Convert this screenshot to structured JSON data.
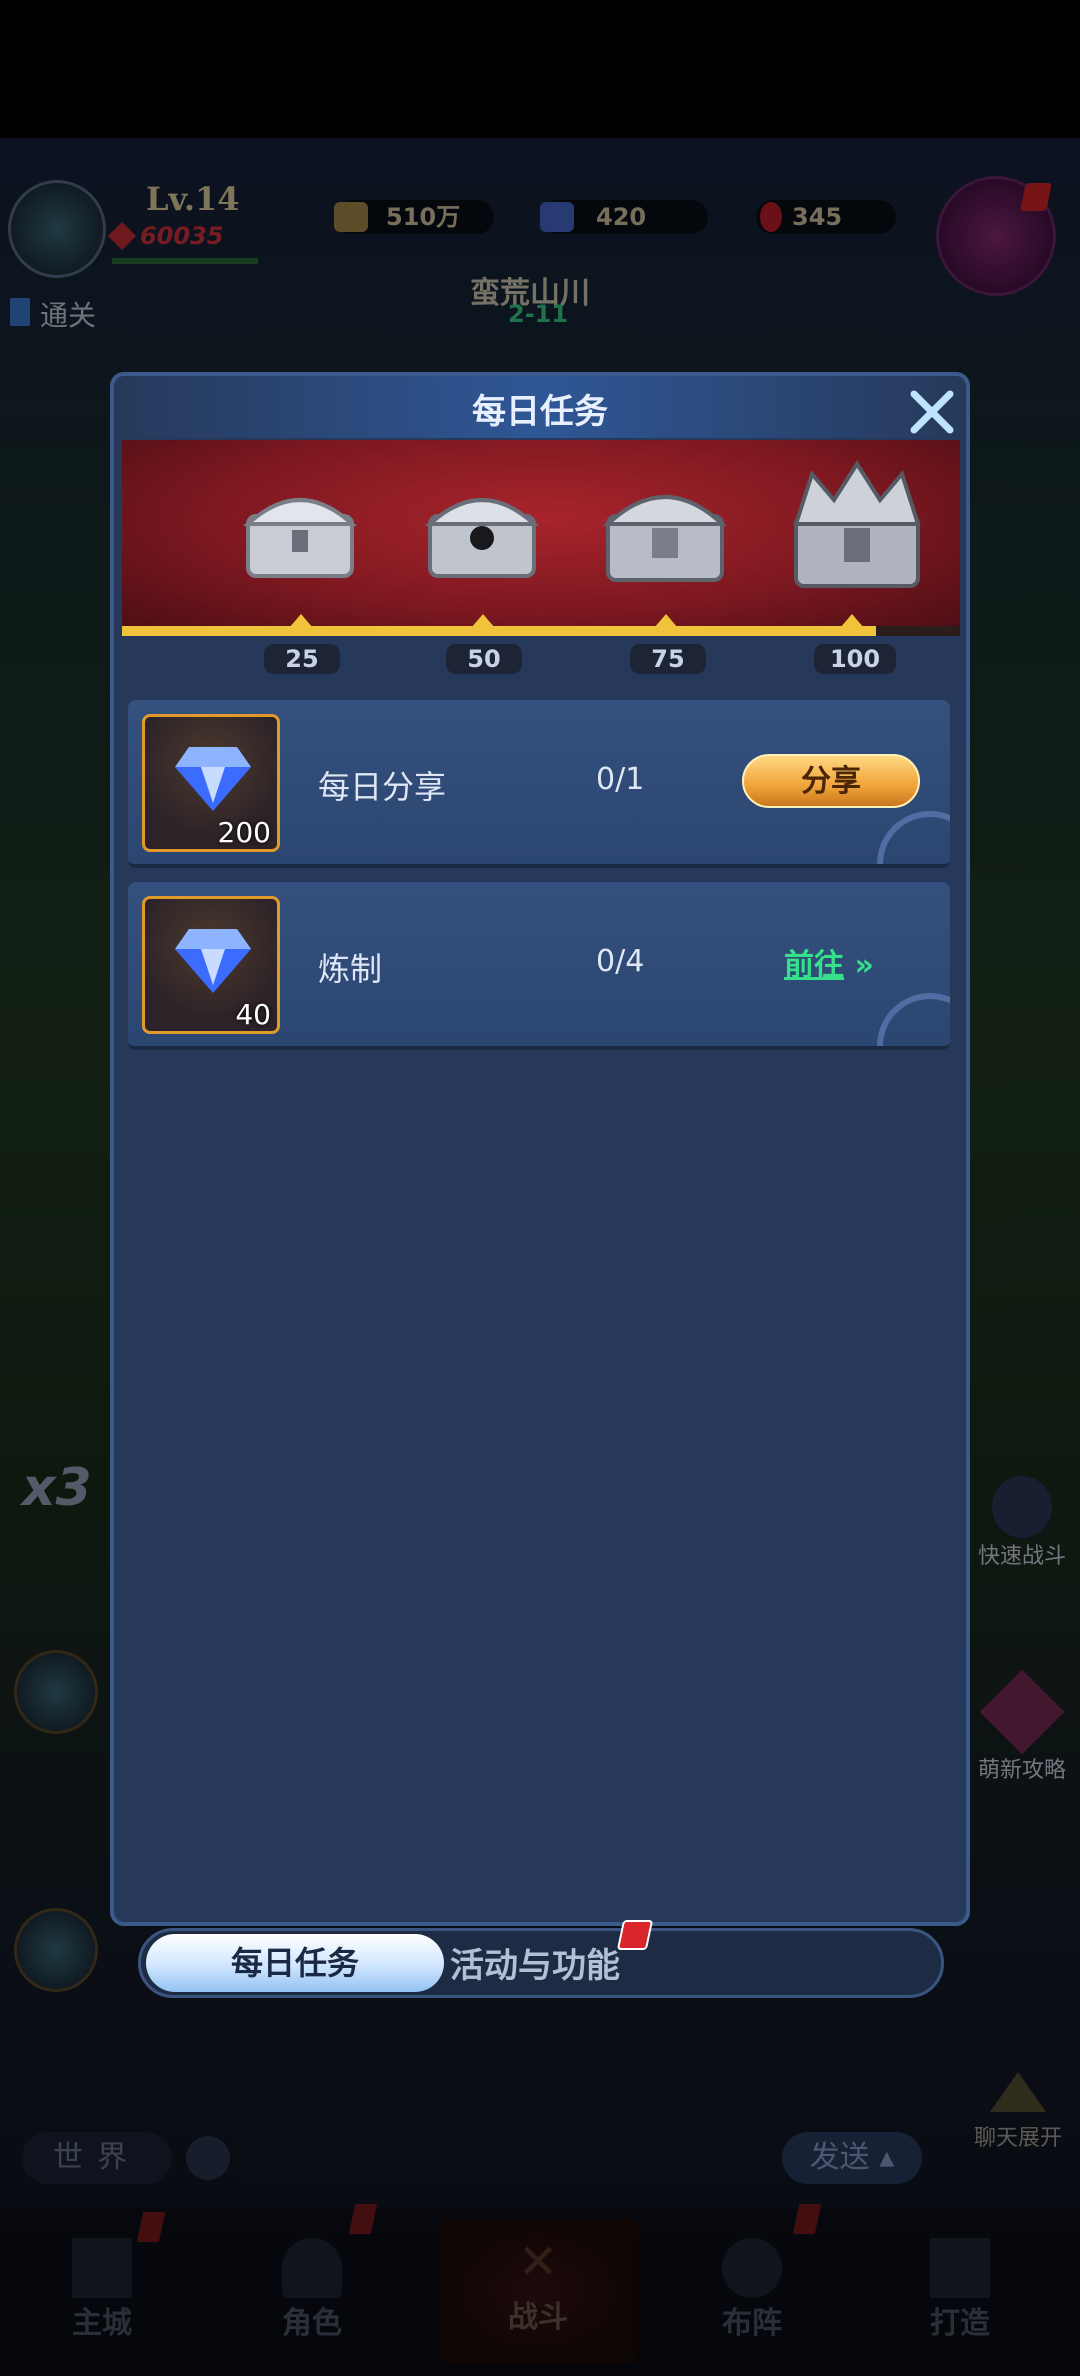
{
  "hud": {
    "level": "Lv.14",
    "power": "60035",
    "gold": "510万",
    "diamonds": "420",
    "gems": "345",
    "stage_name": "蛮荒山川",
    "stage_code": "2-11",
    "left_hint": "通关"
  },
  "side": {
    "speed": "x3",
    "quick_battle": "快速战斗",
    "guide": "萌新攻略",
    "chat_expand": "聊天展开"
  },
  "modal": {
    "title": "每日任务",
    "milestones": [
      "25",
      "50",
      "75",
      "100"
    ],
    "progress": 0.9,
    "tasks": [
      {
        "name": "每日分享",
        "progress": "0/1",
        "reward_qty": "200",
        "action": "分享"
      },
      {
        "name": "炼制",
        "progress": "0/4",
        "reward_qty": "40",
        "action": "前往"
      }
    ]
  },
  "tabs": {
    "daily": "每日任务",
    "events": "活动与功能"
  },
  "chat": {
    "channel": "世界",
    "send": "发送"
  },
  "nav": [
    "主城",
    "角色",
    "战斗",
    "布阵",
    "打造"
  ],
  "colors": {
    "accent_gold": "#f0c43a",
    "goto_green": "#35e08a",
    "modal_bg": "#26395a"
  }
}
